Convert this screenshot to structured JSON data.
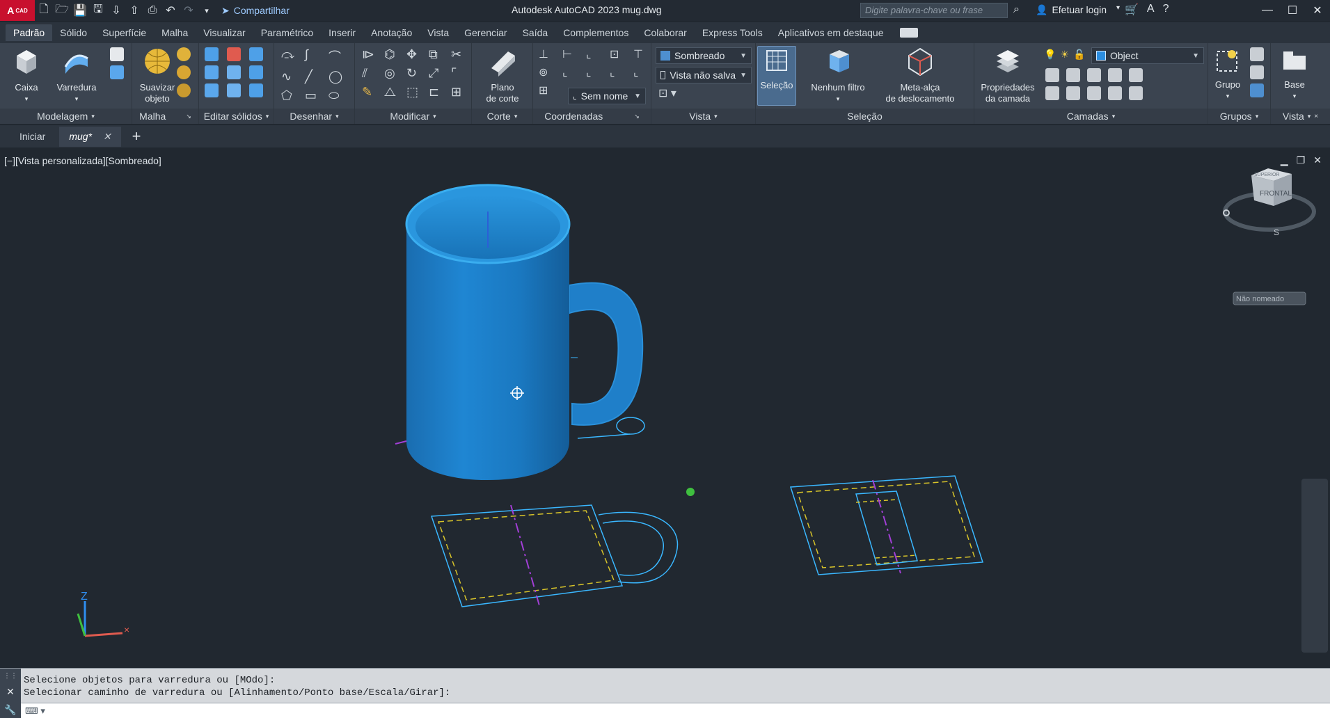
{
  "app": {
    "logo_text": "A",
    "logo_sub": "CAD",
    "share_label": "Compartilhar",
    "title": "Autodesk AutoCAD 2023    mug.dwg",
    "search_placeholder": "Digite palavra-chave ou frase",
    "login_label": "Efetuar login"
  },
  "ribbon_tabs": [
    {
      "label": "Padrão"
    },
    {
      "label": "Sólido"
    },
    {
      "label": "Superfície"
    },
    {
      "label": "Malha"
    },
    {
      "label": "Visualizar"
    },
    {
      "label": "Paramétrico"
    },
    {
      "label": "Inserir"
    },
    {
      "label": "Anotação"
    },
    {
      "label": "Vista"
    },
    {
      "label": "Gerenciar"
    },
    {
      "label": "Saída"
    },
    {
      "label": "Complementos"
    },
    {
      "label": "Colaborar"
    },
    {
      "label": "Express Tools"
    },
    {
      "label": "Aplicativos em destaque"
    }
  ],
  "panels": {
    "modelagem": "Modelagem",
    "malha": "Malha",
    "editar_solidos": "Editar sólidos",
    "desenhar": "Desenhar",
    "modificar": "Modificar",
    "corte": "Corte",
    "coordenadas": "Coordenadas",
    "vista": "Vista",
    "selecao": "Seleção",
    "camadas": "Camadas",
    "grupos": "Grupos",
    "vista2": "Vista"
  },
  "buttons": {
    "caixa": "Caixa",
    "varredura": "Varredura",
    "suavizar_1": "Suavizar",
    "suavizar_2": "objeto",
    "plano_1": "Plano",
    "plano_2": "de corte",
    "selecao": "Seleção",
    "nenhum_filtro": "Nenhum filtro",
    "meta_1": "Meta-alça",
    "meta_2": "de deslocamento",
    "prop_1": "Propriedades",
    "prop_2": "da camada",
    "grupo": "Grupo",
    "base": "Base"
  },
  "dropdowns": {
    "visual_style": "Sombreado",
    "named_view": "Vista não salva",
    "ucs": "Sem nome",
    "layer": "Object"
  },
  "file_tabs": [
    {
      "label": "Iniciar"
    },
    {
      "label": "mug*"
    }
  ],
  "viewport": {
    "label": "[−][Vista personalizada][Sombreado]",
    "viewcube_face": "FRONTAL",
    "viewcube_top": "SUPERIOR",
    "viewcube_south": "S",
    "ucs_menu": "Não nomeado",
    "axis_z": "Z"
  },
  "colors": {
    "mug_fill": "#1f7fc9",
    "mug_rim": "#3aa0e6",
    "profile_line": "#3ab7ff",
    "dashed_yellow": "#d8c42a",
    "axis_magenta": "#a23fd6",
    "green_dot": "#3fbf3f"
  },
  "command": {
    "line1": "Selecione objetos para varredura ou [MOdo]:",
    "line2": "Selecionar caminho de varredura ou [Alinhamento/Ponto base/Escala/Girar]:"
  }
}
